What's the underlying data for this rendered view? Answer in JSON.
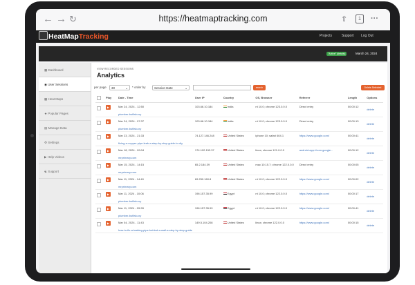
{
  "browser": {
    "back_icon": "back-arrow-icon",
    "forward_icon": "forward-arrow-icon",
    "reload_icon": "reload-icon",
    "url": "https://heatmaptracking.com",
    "tab_count": "1"
  },
  "site": {
    "logo_part1": "HeatMap",
    "logo_part2": "Tracking",
    "links": [
      "Projects",
      "Support",
      "Log Out"
    ],
    "status_badge": "\"Active\" (details)",
    "date": "March 24, 2024"
  },
  "sidebar": {
    "items": [
      {
        "label": "Dashboard",
        "icon": "dashboard-icon"
      },
      {
        "label": "User Sessions",
        "icon": "sessions-icon",
        "active": true
      },
      {
        "label": "Heat Maps",
        "icon": "heatmap-icon"
      },
      {
        "label": "Popular Pages",
        "icon": "star-icon"
      },
      {
        "label": "Manage Data",
        "icon": "data-icon"
      },
      {
        "label": "Settings",
        "icon": "gear-icon"
      },
      {
        "label": "Help Videos",
        "icon": "video-icon"
      },
      {
        "label": "Support",
        "icon": "support-icon"
      }
    ]
  },
  "main": {
    "breadcrumb": "VIEW RECORDED SESSIONS",
    "title": "Analytics",
    "per_page_label": "per page",
    "per_page_value": "30",
    "order_by_label": "order by",
    "order_by_value": "Session Date",
    "search_button": "search",
    "delete_button": "Delete Selected",
    "columns": [
      "Play",
      "Date - Time",
      "User IP",
      "Country",
      "OS, Browser",
      "Referrer",
      "Length",
      "Options"
    ],
    "rows": [
      {
        "datetime": "Mar 24, 2024 - 12:50",
        "page": "plumber-buffalo-ny",
        "ip": "103.66.10.184",
        "country": "India",
        "os": "nt 10.0; chrome 123.0.0.0",
        "referrer": "Direct entry",
        "ref_link": false,
        "length": "00:00:12",
        "option": "delete"
      },
      {
        "datetime": "Mar 24, 2024 - 07:37",
        "page": "plumber-buffalo-ny",
        "ip": "103.66.10.184",
        "country": "India",
        "os": "nt 10.0; chrome 123.0.0.0",
        "referrer": "Direct entry",
        "ref_link": false,
        "length": "00:00:13",
        "option": "delete"
      },
      {
        "datetime": "Mar 23, 2024 - 21:33",
        "page": "fixing-a-copper-pipe-leak-a-step-by-step-guide-to-diy",
        "ip": "74.127.146.248",
        "country": "United States",
        "os": "iphone 10; safari 604.1",
        "referrer": "https://www.google.com/",
        "ref_link": true,
        "length": "00:00:41",
        "option": "delete"
      },
      {
        "datetime": "Mar 18, 2024 - 09:04",
        "page": "mrprimary.com",
        "ip": "174.192.153.37",
        "country": "United States",
        "os": "linux; chrome 121.0.0.0",
        "referrer": "android-app://com.google...",
        "ref_link": true,
        "length": "00:00:12",
        "option": "delete"
      },
      {
        "datetime": "Mar 15, 2024 - 14:15",
        "page": "mrprimary.com",
        "ip": "65.2.184.39",
        "country": "United States",
        "os": "mac 10.15.7; chrome 122.0.0.0",
        "referrer": "Direct entry",
        "ref_link": false,
        "length": "00:00:05",
        "option": "delete"
      },
      {
        "datetime": "Mar 11, 2024 - 14:40",
        "page": "mrprimary.com",
        "ip": "69.250.160.8",
        "country": "United States",
        "os": "nt 10.0; chrome 122.0.0.0",
        "referrer": "https://www.google.com/",
        "ref_link": true,
        "length": "00:00:02",
        "option": "delete"
      },
      {
        "datetime": "Mar 11, 2024 - 10:06",
        "page": "plumber-buffalo-ny",
        "ip": "196.157.35.99",
        "country": "Egypt",
        "os": "nt 10.0; chrome 122.0.0.0",
        "referrer": "https://www.google.com/",
        "ref_link": true,
        "length": "00:00:17",
        "option": "delete"
      },
      {
        "datetime": "Mar 11, 2024 - 09:28",
        "page": "plumber-buffalo-ny",
        "ip": "196.157.35.99",
        "country": "Egypt",
        "os": "nt 10.0; chrome 122.0.0.0",
        "referrer": "https://www.google.com/",
        "ref_link": true,
        "length": "00:00:41",
        "option": "delete"
      },
      {
        "datetime": "Mar 04, 2024 - 11:43",
        "page": "how-to-fix-a-leaking-pipe-behind-a-wall-a-step-by-step-guide",
        "ip": "149.5.104.208",
        "country": "United States",
        "os": "linux; chrome 122.0.0.0",
        "referrer": "https://www.google.com/",
        "ref_link": true,
        "length": "00:00:15",
        "option": "delete"
      }
    ]
  },
  "colors": {
    "accent": "#e4622e",
    "header": "#1e1e1e",
    "link": "#3a6fb8",
    "active_badge": "#3da24a"
  }
}
